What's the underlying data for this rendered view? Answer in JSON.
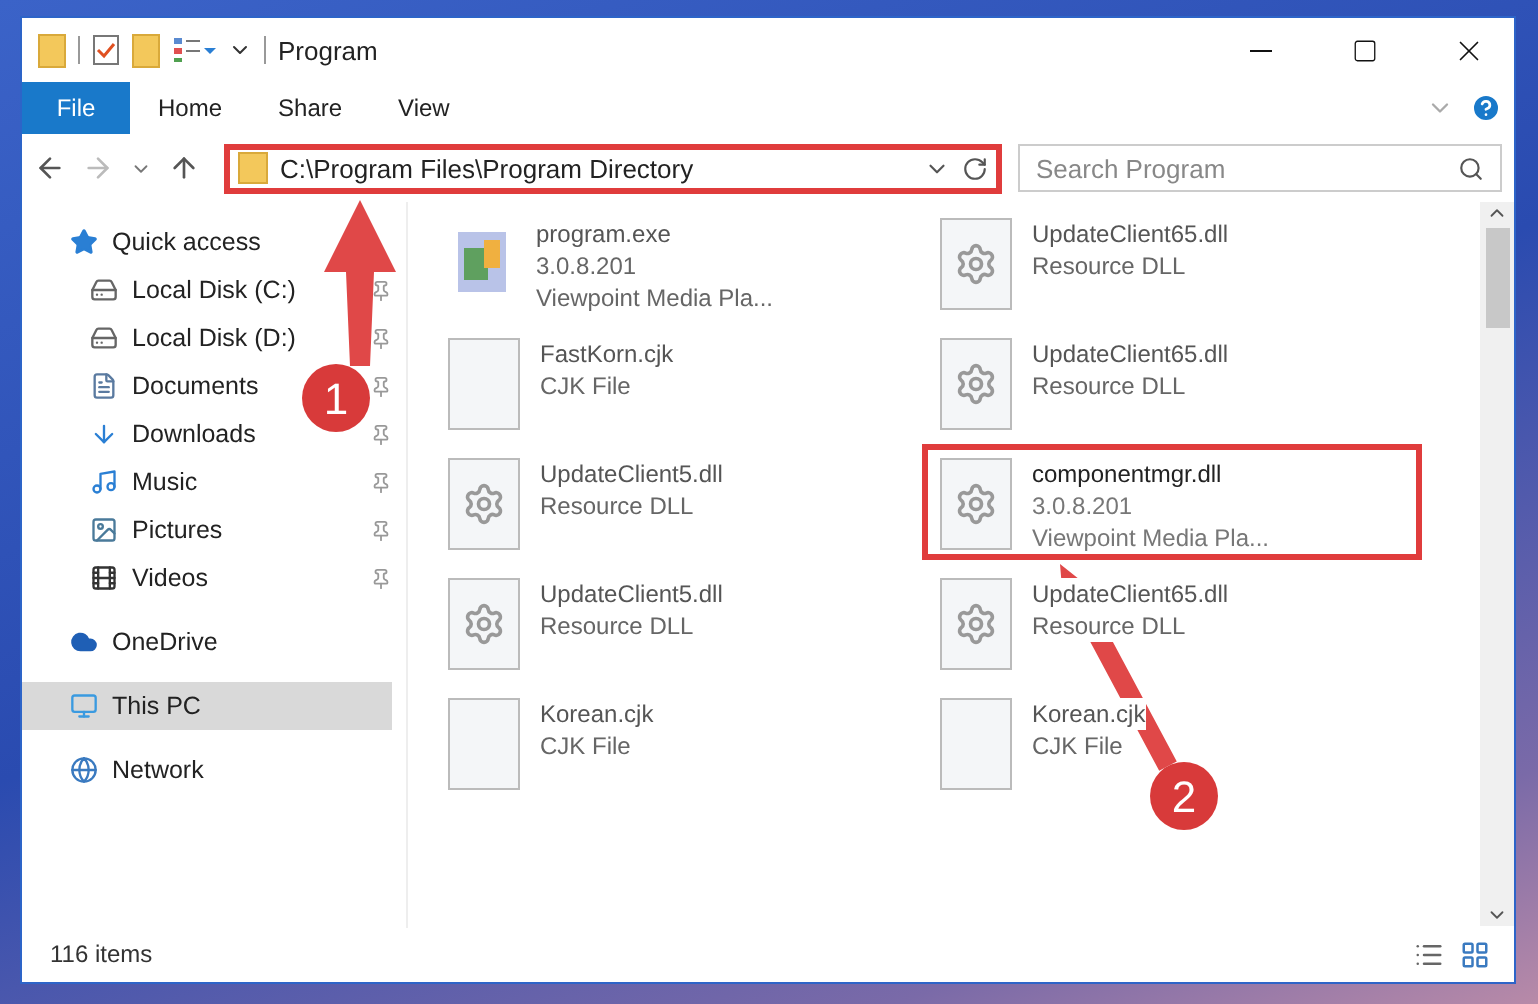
{
  "window": {
    "title": "Program"
  },
  "ribbon": {
    "tabs": [
      {
        "label": "File",
        "selected": true
      },
      {
        "label": "Home",
        "selected": false
      },
      {
        "label": "Share",
        "selected": false
      },
      {
        "label": "View",
        "selected": false
      }
    ]
  },
  "address": {
    "path": "C:\\Program Files\\Program Directory",
    "highlighted": true
  },
  "search": {
    "placeholder": "Search Program"
  },
  "sidebar": {
    "items": [
      {
        "label": "Quick access",
        "kind": "star",
        "selected": false,
        "children": [
          {
            "label": "Local Disk (C:)",
            "kind": "disk",
            "pinned": true,
            "selected": false
          },
          {
            "label": "Local Disk (D:)",
            "kind": "disk",
            "pinned": true,
            "selected": false
          },
          {
            "label": "Documents",
            "kind": "documents",
            "pinned": true,
            "selected": false
          },
          {
            "label": "Downloads",
            "kind": "downloads",
            "pinned": true,
            "selected": false
          },
          {
            "label": "Music",
            "kind": "music",
            "pinned": true,
            "selected": false
          },
          {
            "label": "Pictures",
            "kind": "pictures",
            "pinned": true,
            "selected": false
          },
          {
            "label": "Videos",
            "kind": "videos",
            "pinned": true,
            "selected": false
          }
        ]
      },
      {
        "label": "OneDrive",
        "kind": "cloud",
        "selected": false
      },
      {
        "label": "This PC",
        "kind": "pc",
        "selected": true
      },
      {
        "label": "Network",
        "kind": "network",
        "selected": false
      }
    ]
  },
  "files": [
    {
      "name": "program.exe",
      "kind": "exe",
      "lines": [
        "3.0.8.201",
        "Viewpoint Media Pla..."
      ],
      "highlighted": false
    },
    {
      "name": "UpdateClient65.dll",
      "kind": "dll",
      "lines": [
        "Resource DLL"
      ],
      "highlighted": false
    },
    {
      "name": "FastKorn.cjk",
      "kind": "blank",
      "lines": [
        "CJK File"
      ],
      "highlighted": false
    },
    {
      "name": "UpdateClient65.dll",
      "kind": "dll",
      "lines": [
        "Resource DLL"
      ],
      "highlighted": false
    },
    {
      "name": "UpdateClient5.dll",
      "kind": "dll",
      "lines": [
        "Resource DLL"
      ],
      "highlighted": false
    },
    {
      "name": "componentmgr.dll",
      "kind": "dll",
      "lines": [
        "3.0.8.201",
        "Viewpoint Media Pla..."
      ],
      "highlighted": true
    },
    {
      "name": "UpdateClient5.dll",
      "kind": "dll",
      "lines": [
        "Resource DLL"
      ],
      "highlighted": false
    },
    {
      "name": "UpdateClient65.dll",
      "kind": "dll",
      "lines": [
        "Resource DLL"
      ],
      "highlighted": false
    },
    {
      "name": "Korean.cjk",
      "kind": "blank",
      "lines": [
        "CJK File"
      ],
      "highlighted": false
    },
    {
      "name": "Korean.cjk",
      "kind": "blank",
      "lines": [
        "CJK File"
      ],
      "highlighted": false
    }
  ],
  "status_bar": {
    "count": "116 items"
  },
  "annotations": [
    {
      "number": "1"
    },
    {
      "number": "2"
    }
  ]
}
